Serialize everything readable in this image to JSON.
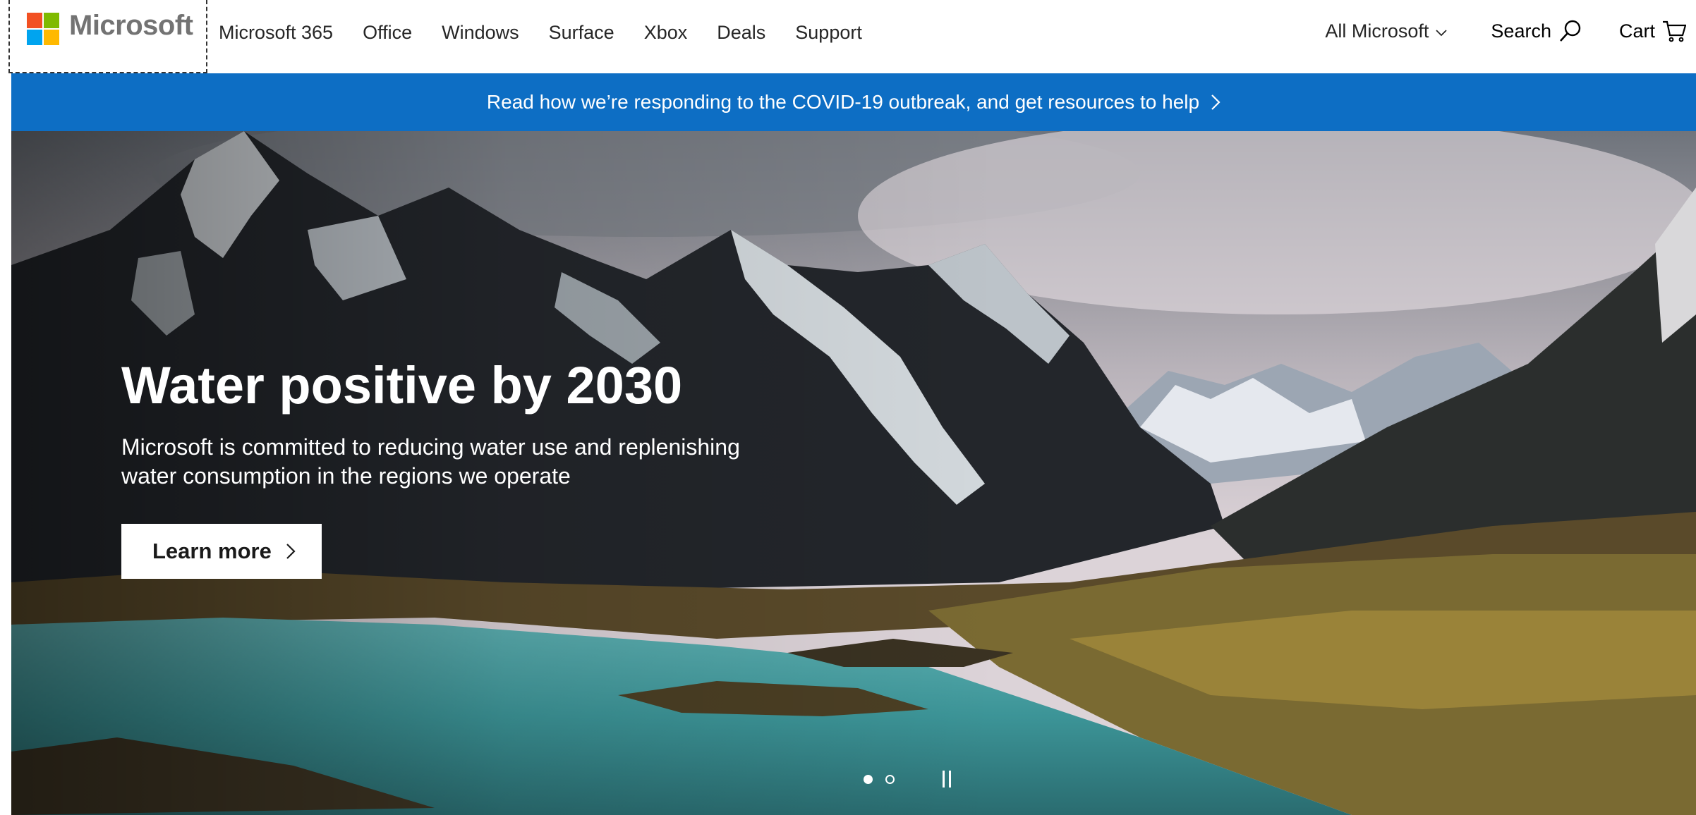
{
  "brand": {
    "name": "Microsoft",
    "logo_colors": [
      "#f25022",
      "#7fba00",
      "#00a4ef",
      "#ffb900"
    ]
  },
  "nav": {
    "items": [
      {
        "label": "Microsoft 365"
      },
      {
        "label": "Office"
      },
      {
        "label": "Windows"
      },
      {
        "label": "Surface"
      },
      {
        "label": "Xbox"
      },
      {
        "label": "Deals"
      },
      {
        "label": "Support"
      }
    ],
    "all_microsoft": "All Microsoft",
    "search": "Search",
    "cart": "Cart"
  },
  "banner": {
    "text": "Read how we’re responding to the COVID-19 outbreak, and get resources to help",
    "color": "#0d6ec4"
  },
  "hero": {
    "title": "Water positive by 2030",
    "text": "Microsoft is committed to reducing water use and replenishing water consumption in the regions we operate",
    "cta": "Learn more",
    "slides": 2,
    "active_slide": 1
  }
}
